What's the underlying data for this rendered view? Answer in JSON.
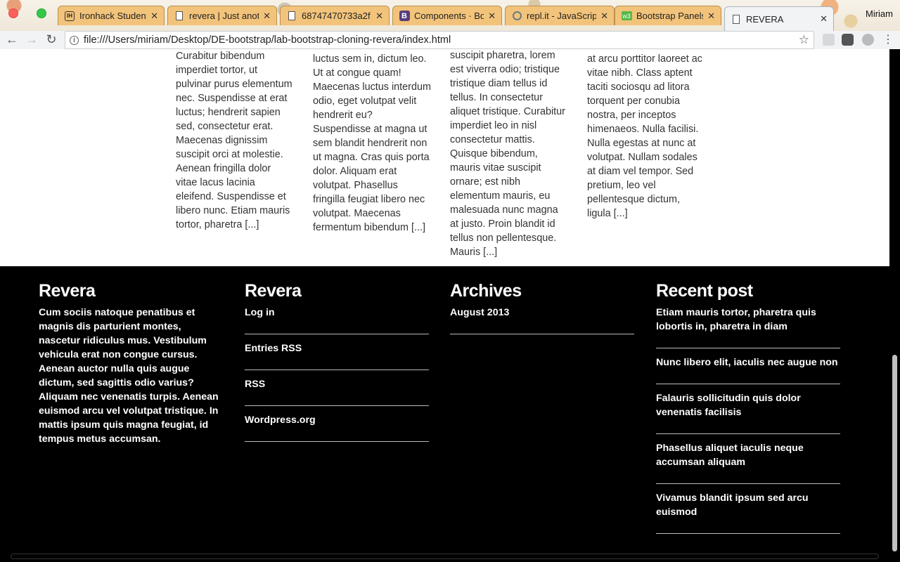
{
  "browser": {
    "tabs": [
      {
        "title": "Ironhack Student P",
        "icon": "ironhack-icon"
      },
      {
        "title": "revera | Just anoth",
        "icon": "document-icon"
      },
      {
        "title": "68747470733a2f",
        "icon": "document-icon"
      },
      {
        "title": "Components · Boo",
        "icon": "bootstrap-icon"
      },
      {
        "title": "repl.it - JavaScrip",
        "icon": "replit-icon"
      },
      {
        "title": "Bootstrap Panels",
        "icon": "panels-icon"
      },
      {
        "title": "REVERA",
        "icon": "document-icon"
      }
    ],
    "profile_name": "Miriam",
    "url": "file:///Users/miriam/Desktop/DE-bootstrap/lab-bootstrap-cloning-revera/index.html"
  },
  "article_columns": [
    {
      "text": "Curabitur bibendum imperdiet tortor, ut pulvinar purus elementum nec. Suspendisse at erat luctus; hendrerit sapien sed, consectetur erat. Maecenas dignissim suscipit orci at molestie. Aenean fringilla dolor vitae lacus lacinia eleifend. Suspendisse et libero nunc. Etiam mauris tortor, pharetra [...]"
    },
    {
      "text": "luctus sem in, dictum leo. Ut at congue quam! Maecenas luctus interdum odio, eget volutpat velit hendrerit eu? Suspendisse at magna ut sem blandit hendrerit non ut magna. Cras quis porta dolor. Aliquam erat volutpat. Phasellus fringilla feugiat libero nec volutpat. Maecenas fermentum bibendum [...]"
    },
    {
      "text": "suscipit pharetra, lorem est viverra odio; tristique tristique diam tellus id tellus. In consectetur aliquet tristique. Curabitur imperdiet leo in nisl consectetur mattis. Quisque bibendum, mauris vitae suscipit ornare; est nibh elementum mauris, eu malesuada nunc magna at justo. Proin blandit id tellus non pellentesque. Mauris [...]"
    },
    {
      "text": "at arcu porttitor laoreet ac vitae nibh. Class aptent taciti sociosqu ad litora torquent per conubia nostra, per inceptos himenaeos. Nulla facilisi. Nulla egestas at nunc at volutpat. Nullam sodales at diam vel tempor. Sed pretium, leo vel pellentesque dictum, ligula [...]"
    }
  ],
  "footer": {
    "about": {
      "heading": "Revera",
      "text": "Cum sociis natoque penatibus et magnis dis parturient montes, nascetur ridiculus mus. Vestibulum vehicula erat non congue cursus. Aenean auctor nulla quis augue dictum, sed sagittis odio varius? Aliquam nec venenatis turpis. Aenean euismod arcu vel volutpat tristique. In mattis ipsum quis magna feugiat, id tempus metus accumsan."
    },
    "meta": {
      "heading": "Revera",
      "links": [
        "Log in",
        "Entries RSS",
        "RSS",
        "Wordpress.org"
      ]
    },
    "archives": {
      "heading": "Archives",
      "links": [
        "August 2013"
      ]
    },
    "recent": {
      "heading": "Recent post",
      "links": [
        "Etiam mauris tortor, pharetra quis lobortis in, pharetra in diam",
        "Nunc libero elit, iaculis nec augue non",
        "Falauris sollicitudin quis dolor venenatis facilisis",
        "Phasellus aliquet iaculis neque accumsan aliquam",
        "Vivamus blandit ipsum sed arcu euismod"
      ]
    }
  }
}
